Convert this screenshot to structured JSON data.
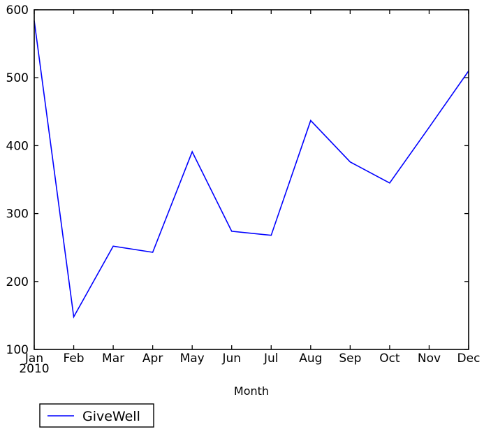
{
  "chart_data": {
    "type": "line",
    "title": "",
    "subtitle": "",
    "xlabel": "Month",
    "ylabel": "",
    "categories": [
      "Jan",
      "Feb",
      "Mar",
      "Apr",
      "May",
      "Jun",
      "Jul",
      "Aug",
      "Sep",
      "Oct",
      "Nov",
      "Dec"
    ],
    "x_sublabel": "2010",
    "series": [
      {
        "name": "GiveWell",
        "color": "#0000ff",
        "values": [
          584,
          148,
          252,
          243,
          391,
          274,
          268,
          437,
          376,
          345,
          427,
          510
        ]
      }
    ],
    "xlim": [
      0,
      11
    ],
    "ylim": [
      100,
      600
    ],
    "yticks": [
      100,
      200,
      300,
      400,
      500,
      600
    ],
    "ytick_labels": [
      "100",
      "200",
      "300",
      "400",
      "500",
      "600"
    ],
    "xticks": [
      0,
      1,
      2,
      3,
      4,
      5,
      6,
      7,
      8,
      9,
      10,
      11
    ],
    "grid": false,
    "legend": {
      "position": "below-left",
      "entries": [
        "GiveWell"
      ]
    },
    "frame": true,
    "tick_direction": "in"
  },
  "figure": {
    "background": "#ffffff",
    "axes_color": "#000000"
  }
}
